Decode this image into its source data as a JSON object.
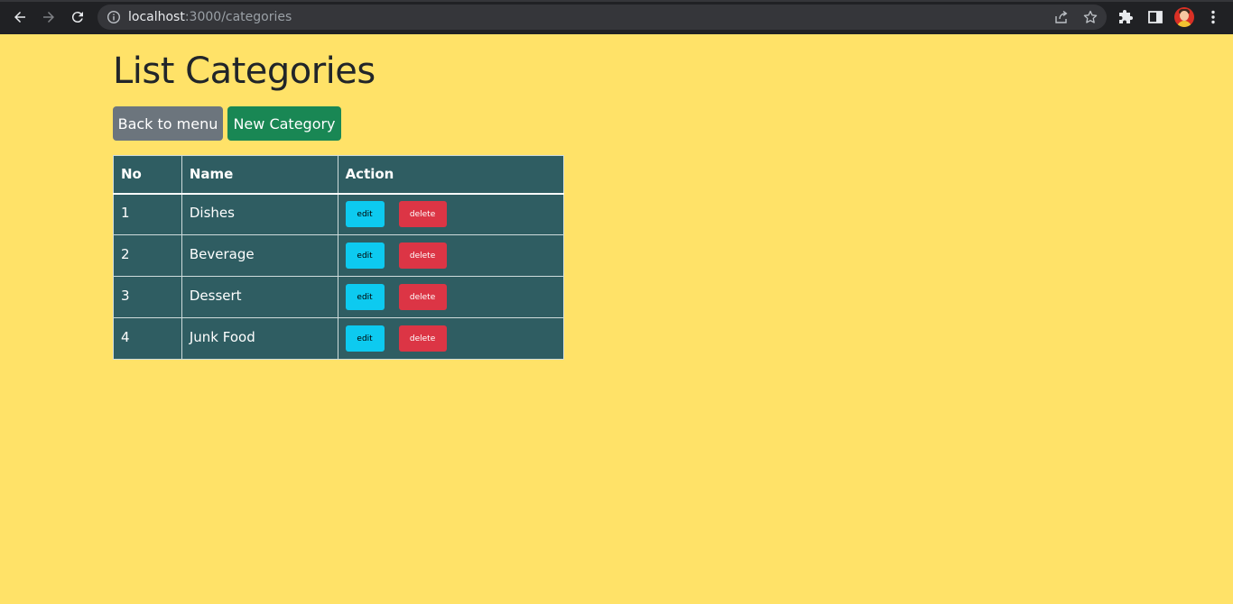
{
  "browser": {
    "url_host": "localhost",
    "url_rest": ":3000/categories"
  },
  "page": {
    "title": "List Categories",
    "back_label": "Back to menu",
    "new_label": "New Category"
  },
  "table": {
    "headers": [
      "No",
      "Name",
      "Action"
    ],
    "rows": [
      {
        "no": "1",
        "name": "Dishes",
        "edit": "edit",
        "delete": "delete"
      },
      {
        "no": "2",
        "name": "Beverage",
        "edit": "edit",
        "delete": "delete"
      },
      {
        "no": "3",
        "name": "Dessert",
        "edit": "edit",
        "delete": "delete"
      },
      {
        "no": "4",
        "name": "Junk Food",
        "edit": "edit",
        "delete": "delete"
      }
    ]
  },
  "colors": {
    "page_bg": "#ffe268",
    "table_bg": "#2f5d62",
    "back_button": "#6c757d",
    "new_button": "#198754",
    "edit_button": "#0dcaf0",
    "delete_button": "#dc3545"
  },
  "icons": [
    "back-arrow-icon",
    "forward-arrow-icon",
    "reload-icon",
    "info-icon",
    "share-icon",
    "star-icon",
    "extensions-icon",
    "side-panel-icon",
    "profile-avatar",
    "more-menu-icon"
  ]
}
